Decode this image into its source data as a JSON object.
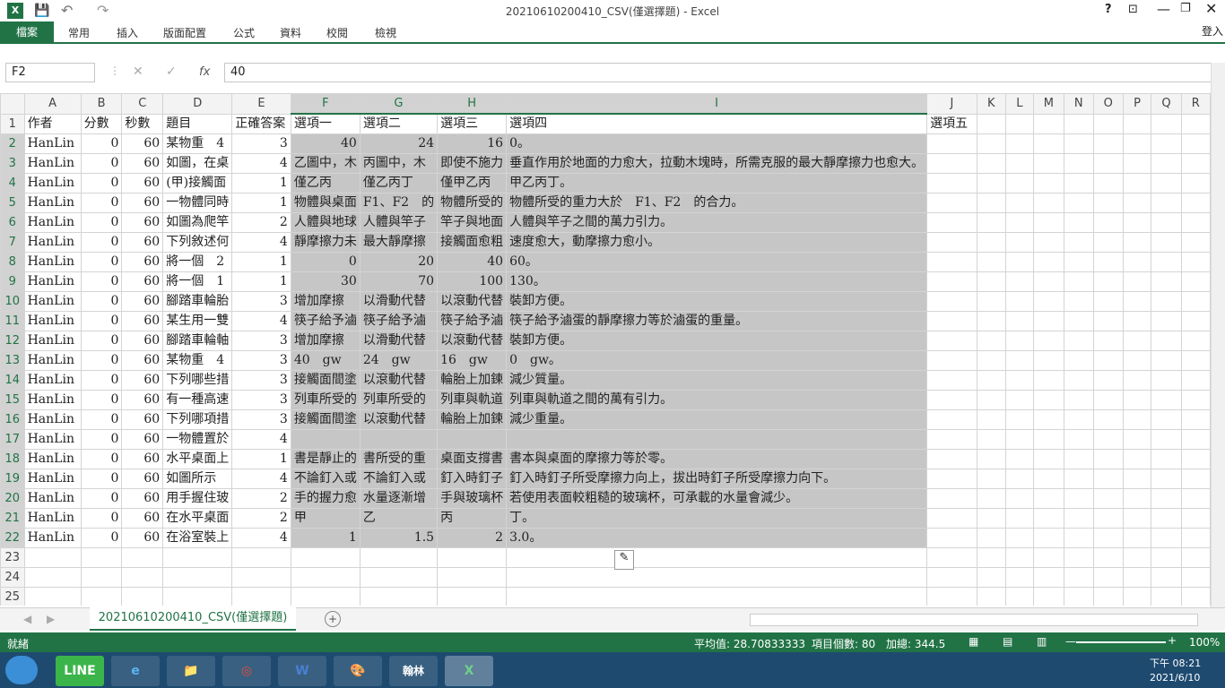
{
  "window": {
    "title": "20210610200410_CSV(僅選擇題) - Excel",
    "signin": "登入",
    "help": "?"
  },
  "ribbon": {
    "file": "檔案",
    "tabs": [
      "常用",
      "插入",
      "版面配置",
      "公式",
      "資料",
      "校閱",
      "檢視"
    ]
  },
  "formula": {
    "namebox": "F2",
    "fx": "fx",
    "value": "40"
  },
  "columns": [
    "A",
    "B",
    "C",
    "D",
    "E",
    "F",
    "G",
    "H",
    "I",
    "J",
    "K",
    "L",
    "M",
    "N",
    "O",
    "P",
    "Q",
    "R"
  ],
  "rows": [
    [
      "作者",
      "分數",
      "秒數",
      "題目",
      "正確答案",
      "選項一",
      "選項二",
      "選項三",
      "選項四",
      "選項五"
    ],
    [
      "HanLin",
      "0",
      "60",
      "某物重　4",
      "3",
      "40",
      "24",
      "16",
      "0。",
      ""
    ],
    [
      "HanLin",
      "0",
      "60",
      "如圖，在桌",
      "4",
      "乙圖中，木",
      "丙圖中，木",
      "即使不施力",
      "垂直作用於地面的力愈大，拉動木塊時，所需克服的最大靜摩擦力也愈大。",
      ""
    ],
    [
      "HanLin",
      "0",
      "60",
      "(甲)接觸面",
      "1",
      "僅乙丙",
      "僅乙丙丁",
      "僅甲乙丙",
      "甲乙丙丁。",
      ""
    ],
    [
      "HanLin",
      "0",
      "60",
      "一物體同時",
      "1",
      "物體與桌面",
      "F1、F2　的",
      "物體所受的",
      "物體所受的重力大於　F1、F2　的合力。",
      ""
    ],
    [
      "HanLin",
      "0",
      "60",
      "如圖為爬竿",
      "2",
      "人體與地球",
      "人體與竿子",
      "竿子與地面",
      "人體與竿子之間的萬力引力。",
      ""
    ],
    [
      "HanLin",
      "0",
      "60",
      "下列敘述何",
      "4",
      "靜摩擦力未",
      "最大靜摩擦",
      "接觸面愈粗",
      "速度愈大，動摩擦力愈小。",
      ""
    ],
    [
      "HanLin",
      "0",
      "60",
      "將一個　2",
      "1",
      "0",
      "20",
      "40",
      "60。",
      ""
    ],
    [
      "HanLin",
      "0",
      "60",
      "將一個　1",
      "1",
      "30",
      "70",
      "100",
      "130。",
      ""
    ],
    [
      "HanLin",
      "0",
      "60",
      "腳踏車輪胎",
      "3",
      "增加摩擦",
      "以滑動代替",
      "以滾動代替",
      "裝卸方便。",
      ""
    ],
    [
      "HanLin",
      "0",
      "60",
      "某生用一雙",
      "4",
      "筷子給予滷",
      "筷子給予滷",
      "筷子給予滷",
      "筷子給予滷蛋的靜摩擦力等於滷蛋的重量。",
      ""
    ],
    [
      "HanLin",
      "0",
      "60",
      "腳踏車輪軸",
      "3",
      "增加摩擦",
      "以滑動代替",
      "以滾動代替",
      "裝卸方便。",
      ""
    ],
    [
      "HanLin",
      "0",
      "60",
      "某物重　4",
      "3",
      "40　gw",
      "24　gw",
      "16　gw",
      "0　gw。",
      ""
    ],
    [
      "HanLin",
      "0",
      "60",
      "下列哪些措",
      "3",
      "接觸面間塗",
      "以滾動代替",
      "輪胎上加鍊",
      "減少質量。",
      ""
    ],
    [
      "HanLin",
      "0",
      "60",
      "有一種高速",
      "3",
      "列車所受的",
      "列車所受的",
      "列車與軌道",
      "列車與軌道之間的萬有引力。",
      ""
    ],
    [
      "HanLin",
      "0",
      "60",
      "下列哪項措",
      "3",
      "接觸面間塗",
      "以滾動代替",
      "輪胎上加鍊",
      "減少重量。",
      ""
    ],
    [
      "HanLin",
      "0",
      "60",
      "一物體置於",
      "4",
      "",
      "",
      "",
      "",
      ""
    ],
    [
      "HanLin",
      "0",
      "60",
      "水平桌面上",
      "1",
      "書是靜止的",
      "書所受的重",
      "桌面支撐書",
      "書本與桌面的摩擦力等於零。",
      ""
    ],
    [
      "HanLin",
      "0",
      "60",
      "如圖所示",
      "4",
      "不論釘入或",
      "不論釘入或",
      "釘入時釘子",
      "釘入時釘子所受摩擦力向上，拔出時釘子所受摩擦力向下。",
      ""
    ],
    [
      "HanLin",
      "0",
      "60",
      "用手握住玻",
      "2",
      "手的握力愈",
      "水量逐漸增",
      "手與玻璃杯",
      "若使用表面較粗糙的玻璃杯，可承載的水量會減少。",
      ""
    ],
    [
      "HanLin",
      "0",
      "60",
      "在水平桌面",
      "2",
      "甲",
      "乙",
      "丙",
      "丁。",
      ""
    ],
    [
      "HanLin",
      "0",
      "60",
      "在浴室裝上",
      "4",
      "1",
      "1.5",
      "2",
      "3.0。",
      ""
    ],
    [
      "",
      "",
      "",
      "",
      "",
      "",
      "",
      "",
      "",
      ""
    ],
    [
      "",
      "",
      "",
      "",
      "",
      "",
      "",
      "",
      "",
      ""
    ],
    [
      "",
      "",
      "",
      "",
      "",
      "",
      "",
      "",
      "",
      ""
    ]
  ],
  "sheet": {
    "tab": "20210610200410_CSV(僅選擇題)",
    "add": "+"
  },
  "status": {
    "ready": "就緒",
    "average": "平均值: 28.70833333",
    "count": "項目個數: 80",
    "sum": "加總: 344.5",
    "zoom": "100%"
  },
  "taskbar": {
    "time": "下午 08:21",
    "date": "2021/6/10",
    "apps": [
      "LINE",
      "e",
      "📁",
      "◎",
      "W",
      "🎨",
      "翰林",
      "X"
    ]
  }
}
